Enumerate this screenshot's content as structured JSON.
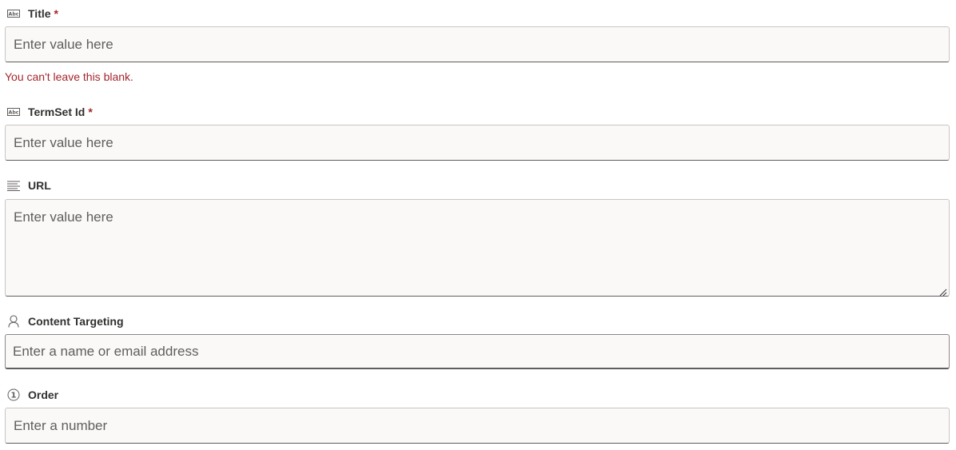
{
  "fields": {
    "title": {
      "label": "Title",
      "required_mark": "*",
      "icon": "text-abc-icon",
      "placeholder": "Enter value here",
      "error": "You can't leave this blank."
    },
    "termset": {
      "label": "TermSet Id",
      "required_mark": "*",
      "icon": "text-abc-icon",
      "placeholder": "Enter value here"
    },
    "url": {
      "label": "URL",
      "icon": "multiline-text-icon",
      "placeholder": "Enter value here"
    },
    "targeting": {
      "label": "Content Targeting",
      "icon": "person-icon",
      "placeholder": "Enter a name or email address"
    },
    "order": {
      "label": "Order",
      "icon": "number-icon",
      "placeholder": "Enter a number"
    }
  },
  "colors": {
    "error": "#a4262c",
    "input_bg": "#faf9f8",
    "label": "#323130",
    "placeholder": "#605e5c"
  }
}
